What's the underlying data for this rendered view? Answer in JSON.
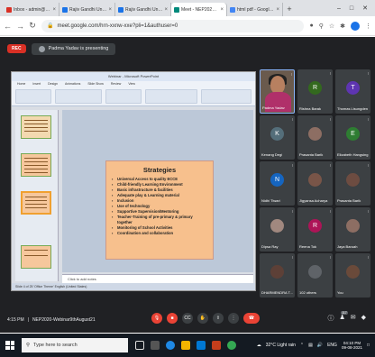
{
  "browser": {
    "tabs": [
      {
        "label": "Inbox - admin@gpoddr",
        "fav": "#d93025",
        "active": false
      },
      {
        "label": "Rajiv Gandhi Universit",
        "fav": "#1a73e8",
        "active": false
      },
      {
        "label": "Rajiv Gandhi University",
        "fav": "#1a73e8",
        "active": false
      },
      {
        "label": "Meet - NEP2020-Wc",
        "fav": "#00897b",
        "active": true
      },
      {
        "label": "html pdf - Google Sear",
        "fav": "#4285f4",
        "active": false
      }
    ],
    "url": "meet.google.com/hrn-xxnw-xxe?pli=1&authuser=0",
    "window_controls": [
      "–",
      "□",
      "✕"
    ]
  },
  "meet": {
    "rec_label": "REC",
    "presenting_text": "Padma Yadav is presenting",
    "meeting_time": "4:15 PM",
    "meeting_name": "NEP2020-Webinar9thAugust21",
    "participants": [
      {
        "name": "Padma Yadav",
        "initial": "",
        "color": "",
        "video": true
      },
      {
        "name": "Rishna Barak",
        "initial": "R",
        "color": "#33691e"
      },
      {
        "name": "Thomas Lisungden",
        "initial": "T",
        "color": "#5e35b1"
      },
      {
        "name": "Kenang Degi",
        "initial": "K",
        "color": "#546e7a"
      },
      {
        "name": "Prasanta Barik",
        "initial": "",
        "color": "#8d6e63",
        "photo": true
      },
      {
        "name": "Elizabeth Hangsing",
        "initial": "E",
        "color": "#2e7d32"
      },
      {
        "name": "Nidhi Tiwari",
        "initial": "N",
        "color": "#1565c0"
      },
      {
        "name": "Jigyansa Acharya",
        "initial": "",
        "color": "#795548",
        "photo": true
      },
      {
        "name": "Prasanta Barik",
        "initial": "",
        "color": "#6d4c41",
        "photo": true
      },
      {
        "name": "Dipsa Ray",
        "initial": "",
        "color": "#a1887f",
        "photo": true
      },
      {
        "name": "Reena Tok",
        "initial": "R",
        "color": "#ad1457"
      },
      {
        "name": "Jaya Baruah",
        "initial": "",
        "color": "#8d6e63",
        "photo": true
      },
      {
        "name": "DHARMENDRA T...",
        "initial": "",
        "color": "#5d4037",
        "photo": true
      },
      {
        "name": "102 others",
        "initial": "",
        "color": "#5f6368",
        "photo": false
      },
      {
        "name": "You",
        "initial": "",
        "color": "#6a4a3a",
        "photo": true
      }
    ],
    "right_badge": "117"
  },
  "ppt": {
    "window_title": "Webinar - Microsoft PowerPoint",
    "ribbon_tabs": [
      "Home",
      "Insert",
      "Design",
      "Animations",
      "Slide Show",
      "Review",
      "View"
    ],
    "slide_title": "Strategies",
    "bullets": [
      "Universal Access to quality ECCE",
      "Child-friendly Learning Environment",
      "Basic infrastructure & facilities",
      "Adequate play & Learning material",
      "Inclusion",
      "Use of technology",
      "Supportive Supervision/Mentoring",
      "Teacher-Training of pre-primary & primary together",
      "Monitoring of School Activities",
      "Coordination and collaboration"
    ],
    "notes_placeholder": "Click to add notes",
    "status_text": "Slide 4 of 25   'Office Theme'   English (United States)"
  },
  "taskbar": {
    "search_placeholder": "Type here to search",
    "weather": "32°C Light rain",
    "lang": "ENG",
    "time": "04:10 PM",
    "date": "09-08-2021"
  }
}
